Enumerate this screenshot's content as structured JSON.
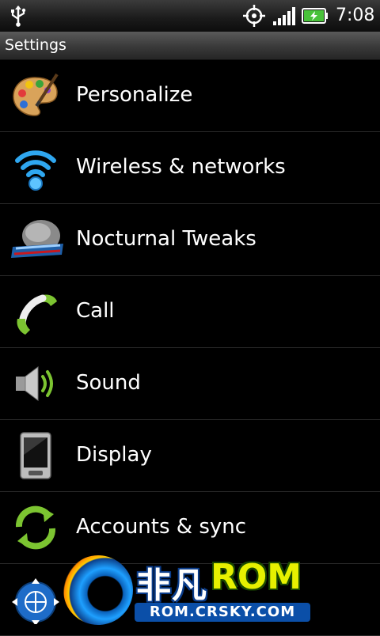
{
  "status_bar": {
    "time": "7:08",
    "icons": [
      "usb-icon",
      "gps-icon",
      "signal-icon",
      "battery-charging-icon"
    ]
  },
  "header": {
    "title": "Settings"
  },
  "settings_items": [
    {
      "label": "Personalize",
      "icon": "palette-icon"
    },
    {
      "label": "Wireless & networks",
      "icon": "wifi-icon"
    },
    {
      "label": "Nocturnal Tweaks",
      "icon": "nocturnal-logo-icon"
    },
    {
      "label": "Call",
      "icon": "phone-handset-icon"
    },
    {
      "label": "Sound",
      "icon": "speaker-icon"
    },
    {
      "label": "Display",
      "icon": "phone-display-icon"
    },
    {
      "label": "Accounts & sync",
      "icon": "sync-icon"
    },
    {
      "label": "",
      "icon": "globe-location-icon"
    }
  ],
  "watermark": {
    "brand_cn": "非凡",
    "brand": "ROM",
    "url": "ROM.CRSKY.COM"
  },
  "colors": {
    "background": "#000000",
    "text": "#ffffff",
    "divider": "#2a2a2a",
    "accent_green": "#7cc431"
  }
}
